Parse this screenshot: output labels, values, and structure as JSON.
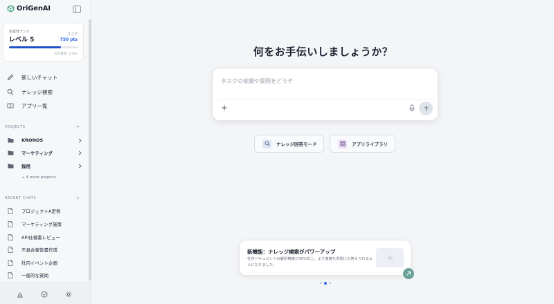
{
  "app": {
    "name": "OriGenAI"
  },
  "rank_card": {
    "rank_label": "生産性ランク",
    "rank_value": "レベル 5",
    "score_label": "スコア",
    "score_value": "750 pts",
    "progress_percent": 75,
    "next_goal": "次の目標: 1,000"
  },
  "nav": [
    {
      "label": "新しいチャット",
      "icon": "pencil-icon"
    },
    {
      "label": "ナレッジ検索",
      "icon": "search-icon"
    },
    {
      "label": "アプリ一覧",
      "icon": "book-icon"
    }
  ],
  "projects": {
    "title": "PROJECTS",
    "items": [
      "KRONOS",
      "マーケティング",
      "採用"
    ],
    "more": "+ 4 more projects"
  },
  "recent_chats": {
    "title": "RECENT CHATS",
    "items": [
      "プロジェクトA定例",
      "マーケティング施策",
      "API仕様書レビュー",
      "不具合報告書作成",
      "社内イベント企画",
      "一般的な質問"
    ]
  },
  "main": {
    "heading": "何をお手伝いしましょうか？",
    "input_placeholder": "タスクの依頼や質問をどうぞ",
    "input_value": "",
    "modes": [
      {
        "label": "ナレッジ回答モード",
        "icon": "search-icon"
      },
      {
        "label": "アプリライブラリ",
        "icon": "grid-icon"
      }
    ],
    "news": {
      "title": "新機能：ナレッジ検索がパワーアップ",
      "description": "社内ドキュメントの解析精度が30%向上。より複雑な質問にも答えられるようになりました。"
    },
    "carousel": {
      "count": 3,
      "active": 1
    }
  },
  "colors": {
    "accent": "#2050c8",
    "score": "#2563eb",
    "go_button": "#6aa39a"
  }
}
